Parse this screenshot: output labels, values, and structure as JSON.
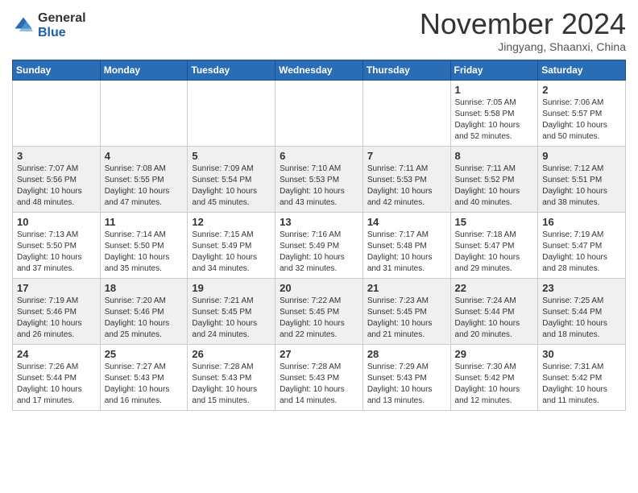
{
  "header": {
    "logo_general": "General",
    "logo_blue": "Blue",
    "month_title": "November 2024",
    "subtitle": "Jingyang, Shaanxi, China"
  },
  "weekdays": [
    "Sunday",
    "Monday",
    "Tuesday",
    "Wednesday",
    "Thursday",
    "Friday",
    "Saturday"
  ],
  "weeks": [
    [
      {
        "day": "",
        "info": ""
      },
      {
        "day": "",
        "info": ""
      },
      {
        "day": "",
        "info": ""
      },
      {
        "day": "",
        "info": ""
      },
      {
        "day": "",
        "info": ""
      },
      {
        "day": "1",
        "info": "Sunrise: 7:05 AM\nSunset: 5:58 PM\nDaylight: 10 hours\nand 52 minutes."
      },
      {
        "day": "2",
        "info": "Sunrise: 7:06 AM\nSunset: 5:57 PM\nDaylight: 10 hours\nand 50 minutes."
      }
    ],
    [
      {
        "day": "3",
        "info": "Sunrise: 7:07 AM\nSunset: 5:56 PM\nDaylight: 10 hours\nand 48 minutes."
      },
      {
        "day": "4",
        "info": "Sunrise: 7:08 AM\nSunset: 5:55 PM\nDaylight: 10 hours\nand 47 minutes."
      },
      {
        "day": "5",
        "info": "Sunrise: 7:09 AM\nSunset: 5:54 PM\nDaylight: 10 hours\nand 45 minutes."
      },
      {
        "day": "6",
        "info": "Sunrise: 7:10 AM\nSunset: 5:53 PM\nDaylight: 10 hours\nand 43 minutes."
      },
      {
        "day": "7",
        "info": "Sunrise: 7:11 AM\nSunset: 5:53 PM\nDaylight: 10 hours\nand 42 minutes."
      },
      {
        "day": "8",
        "info": "Sunrise: 7:11 AM\nSunset: 5:52 PM\nDaylight: 10 hours\nand 40 minutes."
      },
      {
        "day": "9",
        "info": "Sunrise: 7:12 AM\nSunset: 5:51 PM\nDaylight: 10 hours\nand 38 minutes."
      }
    ],
    [
      {
        "day": "10",
        "info": "Sunrise: 7:13 AM\nSunset: 5:50 PM\nDaylight: 10 hours\nand 37 minutes."
      },
      {
        "day": "11",
        "info": "Sunrise: 7:14 AM\nSunset: 5:50 PM\nDaylight: 10 hours\nand 35 minutes."
      },
      {
        "day": "12",
        "info": "Sunrise: 7:15 AM\nSunset: 5:49 PM\nDaylight: 10 hours\nand 34 minutes."
      },
      {
        "day": "13",
        "info": "Sunrise: 7:16 AM\nSunset: 5:49 PM\nDaylight: 10 hours\nand 32 minutes."
      },
      {
        "day": "14",
        "info": "Sunrise: 7:17 AM\nSunset: 5:48 PM\nDaylight: 10 hours\nand 31 minutes."
      },
      {
        "day": "15",
        "info": "Sunrise: 7:18 AM\nSunset: 5:47 PM\nDaylight: 10 hours\nand 29 minutes."
      },
      {
        "day": "16",
        "info": "Sunrise: 7:19 AM\nSunset: 5:47 PM\nDaylight: 10 hours\nand 28 minutes."
      }
    ],
    [
      {
        "day": "17",
        "info": "Sunrise: 7:19 AM\nSunset: 5:46 PM\nDaylight: 10 hours\nand 26 minutes."
      },
      {
        "day": "18",
        "info": "Sunrise: 7:20 AM\nSunset: 5:46 PM\nDaylight: 10 hours\nand 25 minutes."
      },
      {
        "day": "19",
        "info": "Sunrise: 7:21 AM\nSunset: 5:45 PM\nDaylight: 10 hours\nand 24 minutes."
      },
      {
        "day": "20",
        "info": "Sunrise: 7:22 AM\nSunset: 5:45 PM\nDaylight: 10 hours\nand 22 minutes."
      },
      {
        "day": "21",
        "info": "Sunrise: 7:23 AM\nSunset: 5:45 PM\nDaylight: 10 hours\nand 21 minutes."
      },
      {
        "day": "22",
        "info": "Sunrise: 7:24 AM\nSunset: 5:44 PM\nDaylight: 10 hours\nand 20 minutes."
      },
      {
        "day": "23",
        "info": "Sunrise: 7:25 AM\nSunset: 5:44 PM\nDaylight: 10 hours\nand 18 minutes."
      }
    ],
    [
      {
        "day": "24",
        "info": "Sunrise: 7:26 AM\nSunset: 5:44 PM\nDaylight: 10 hours\nand 17 minutes."
      },
      {
        "day": "25",
        "info": "Sunrise: 7:27 AM\nSunset: 5:43 PM\nDaylight: 10 hours\nand 16 minutes."
      },
      {
        "day": "26",
        "info": "Sunrise: 7:28 AM\nSunset: 5:43 PM\nDaylight: 10 hours\nand 15 minutes."
      },
      {
        "day": "27",
        "info": "Sunrise: 7:28 AM\nSunset: 5:43 PM\nDaylight: 10 hours\nand 14 minutes."
      },
      {
        "day": "28",
        "info": "Sunrise: 7:29 AM\nSunset: 5:43 PM\nDaylight: 10 hours\nand 13 minutes."
      },
      {
        "day": "29",
        "info": "Sunrise: 7:30 AM\nSunset: 5:42 PM\nDaylight: 10 hours\nand 12 minutes."
      },
      {
        "day": "30",
        "info": "Sunrise: 7:31 AM\nSunset: 5:42 PM\nDaylight: 10 hours\nand 11 minutes."
      }
    ]
  ]
}
